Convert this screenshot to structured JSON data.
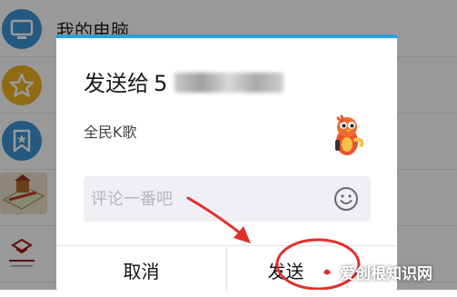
{
  "background": {
    "top_item_title": "我的电脑"
  },
  "dialog": {
    "recipient_label": "发送给",
    "recipient_name_obscured": "5",
    "share_title": "全民K歌",
    "comment": {
      "value": "",
      "placeholder": "评论一番吧"
    },
    "cancel_label": "取消",
    "send_label": "发送"
  },
  "watermark": {
    "text": "爱创根知识网"
  },
  "colors": {
    "accent_topbar": "#2d9ee0",
    "annotation_red": "#e0302b",
    "overlay": "rgba(0,0,0,0.40)"
  },
  "icons": [
    "computer-icon",
    "favorite-star-icon",
    "bookmark-icon",
    "map-icon",
    "brand-logo-icon",
    "parrot-mascot-icon",
    "emoji-icon"
  ]
}
